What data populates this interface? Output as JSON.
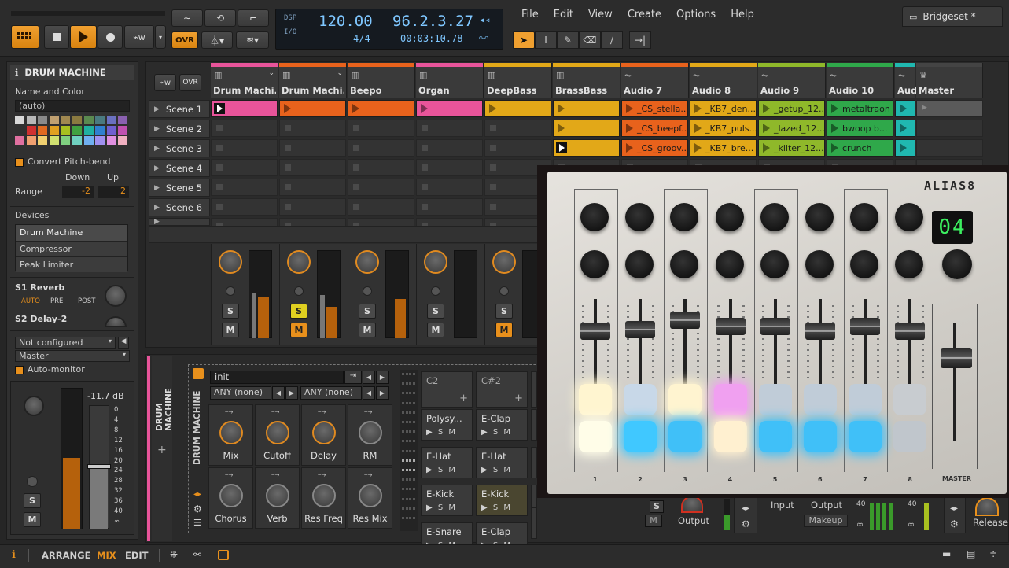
{
  "transport": {
    "ovr_label": "OVR",
    "dsp_label": "DSP",
    "io_label": "I/O",
    "tempo": "120.00",
    "time_sig": "4/4",
    "position": "96.2.3.27",
    "time": "00:03:10.78"
  },
  "menu": [
    "File",
    "Edit",
    "View",
    "Create",
    "Options",
    "Help"
  ],
  "project_tab": "Bridgeset *",
  "inspector": {
    "title": "DRUM MACHINE",
    "name_color_label": "Name and Color",
    "name_value": "(auto)",
    "convert_pitchbend": "Convert Pitch-bend",
    "down_label": "Down",
    "up_label": "Up",
    "range_label": "Range",
    "range_down": "-2",
    "range_up": "2",
    "devices_label": "Devices",
    "devices": [
      "Drum Machine",
      "Compressor",
      "Peak Limiter"
    ],
    "send1": "S1 Reverb",
    "send_modes": [
      "AUTO",
      "PRE",
      "POST"
    ],
    "send2": "S2 Delay-2",
    "input_value": "Not configured",
    "output_value": "Master",
    "auto_monitor": "Auto-monitor",
    "level_db": "-11.7 dB",
    "meter_scale": [
      "0",
      "4",
      "8",
      "12",
      "16",
      "20",
      "24",
      "28",
      "32",
      "36",
      "40",
      "∞"
    ],
    "s_label": "S",
    "m_label": "M"
  },
  "mixer": {
    "ovr_label": "OVR",
    "tracks": [
      {
        "name": "Drum Machi...",
        "color": "#e8549a"
      },
      {
        "name": "Drum Machi...",
        "color": "#e8621c"
      },
      {
        "name": "Beepo",
        "color": "#e8621c"
      },
      {
        "name": "Organ",
        "color": "#e8549a"
      },
      {
        "name": "DeepBass",
        "color": "#e2a818"
      },
      {
        "name": "BrassBass",
        "color": "#e2a818"
      },
      {
        "name": "Audio 7",
        "color": "#e8621c"
      },
      {
        "name": "Audio 8",
        "color": "#e2a818"
      },
      {
        "name": "Audio 9",
        "color": "#8fb82a"
      },
      {
        "name": "Audio 10",
        "color": "#2fa84a"
      },
      {
        "name": "Audi",
        "color": "#20b8b0"
      },
      {
        "name": "Master",
        "color": "#444444"
      }
    ],
    "scenes": [
      "Scene 1",
      "Scene 2",
      "Scene 3",
      "Scene 4",
      "Scene 5",
      "Scene 6"
    ],
    "clips": {
      "r1": [
        "_CS_stella...",
        "_KB7_den...",
        "_getup_12...",
        "metaltraon"
      ],
      "r2": [
        "_CS_beepf...",
        "_KB7_puls...",
        "_lazed_12...",
        "bwoop b..."
      ],
      "r3": [
        "_CS_groov...",
        "_KB7_bre...",
        "_kilter_12...",
        "crunch"
      ]
    },
    "s_label": "S",
    "m_label": "M"
  },
  "drum_machine": {
    "side_title": "DRUM MACHINE",
    "device_title": "DRUM MACHINE",
    "preset": "init",
    "any1": "ANY (none)",
    "any2": "ANY (none)",
    "knobs": [
      "Mix",
      "Cutoff",
      "Delay",
      "RM",
      "Chorus",
      "Verb",
      "Res Freq",
      "Res Mix"
    ],
    "pads": [
      {
        "label": "C2",
        "empty": true
      },
      {
        "label": "C#2",
        "empty": true
      },
      {
        "label": "Polysy...",
        "empty": false
      },
      {
        "label": "E-Clap",
        "empty": false
      },
      {
        "label": "E-Hat",
        "empty": false
      },
      {
        "label": "E-Hat",
        "empty": false
      },
      {
        "label": "E-Kick",
        "empty": false
      },
      {
        "label": "E-Kick",
        "empty": false
      },
      {
        "label": "E-Snare",
        "empty": false
      },
      {
        "label": "E-Clap",
        "empty": false
      }
    ],
    "pad_ctrl": "▶ S M",
    "output_label": "Output",
    "comp_input": "Input",
    "comp_output": "Output",
    "comp_makeup": "Makeup",
    "release_label": "Release",
    "scale_40": "40",
    "inf": "∞"
  },
  "controller": {
    "brand": "ALIAS8",
    "display": "04",
    "channels": [
      "1",
      "2",
      "3",
      "4",
      "5",
      "6",
      "7",
      "8"
    ],
    "master_label": "MASTER"
  },
  "footer": {
    "arrange": "ARRANGE",
    "mix": "MIX",
    "edit": "EDIT"
  }
}
